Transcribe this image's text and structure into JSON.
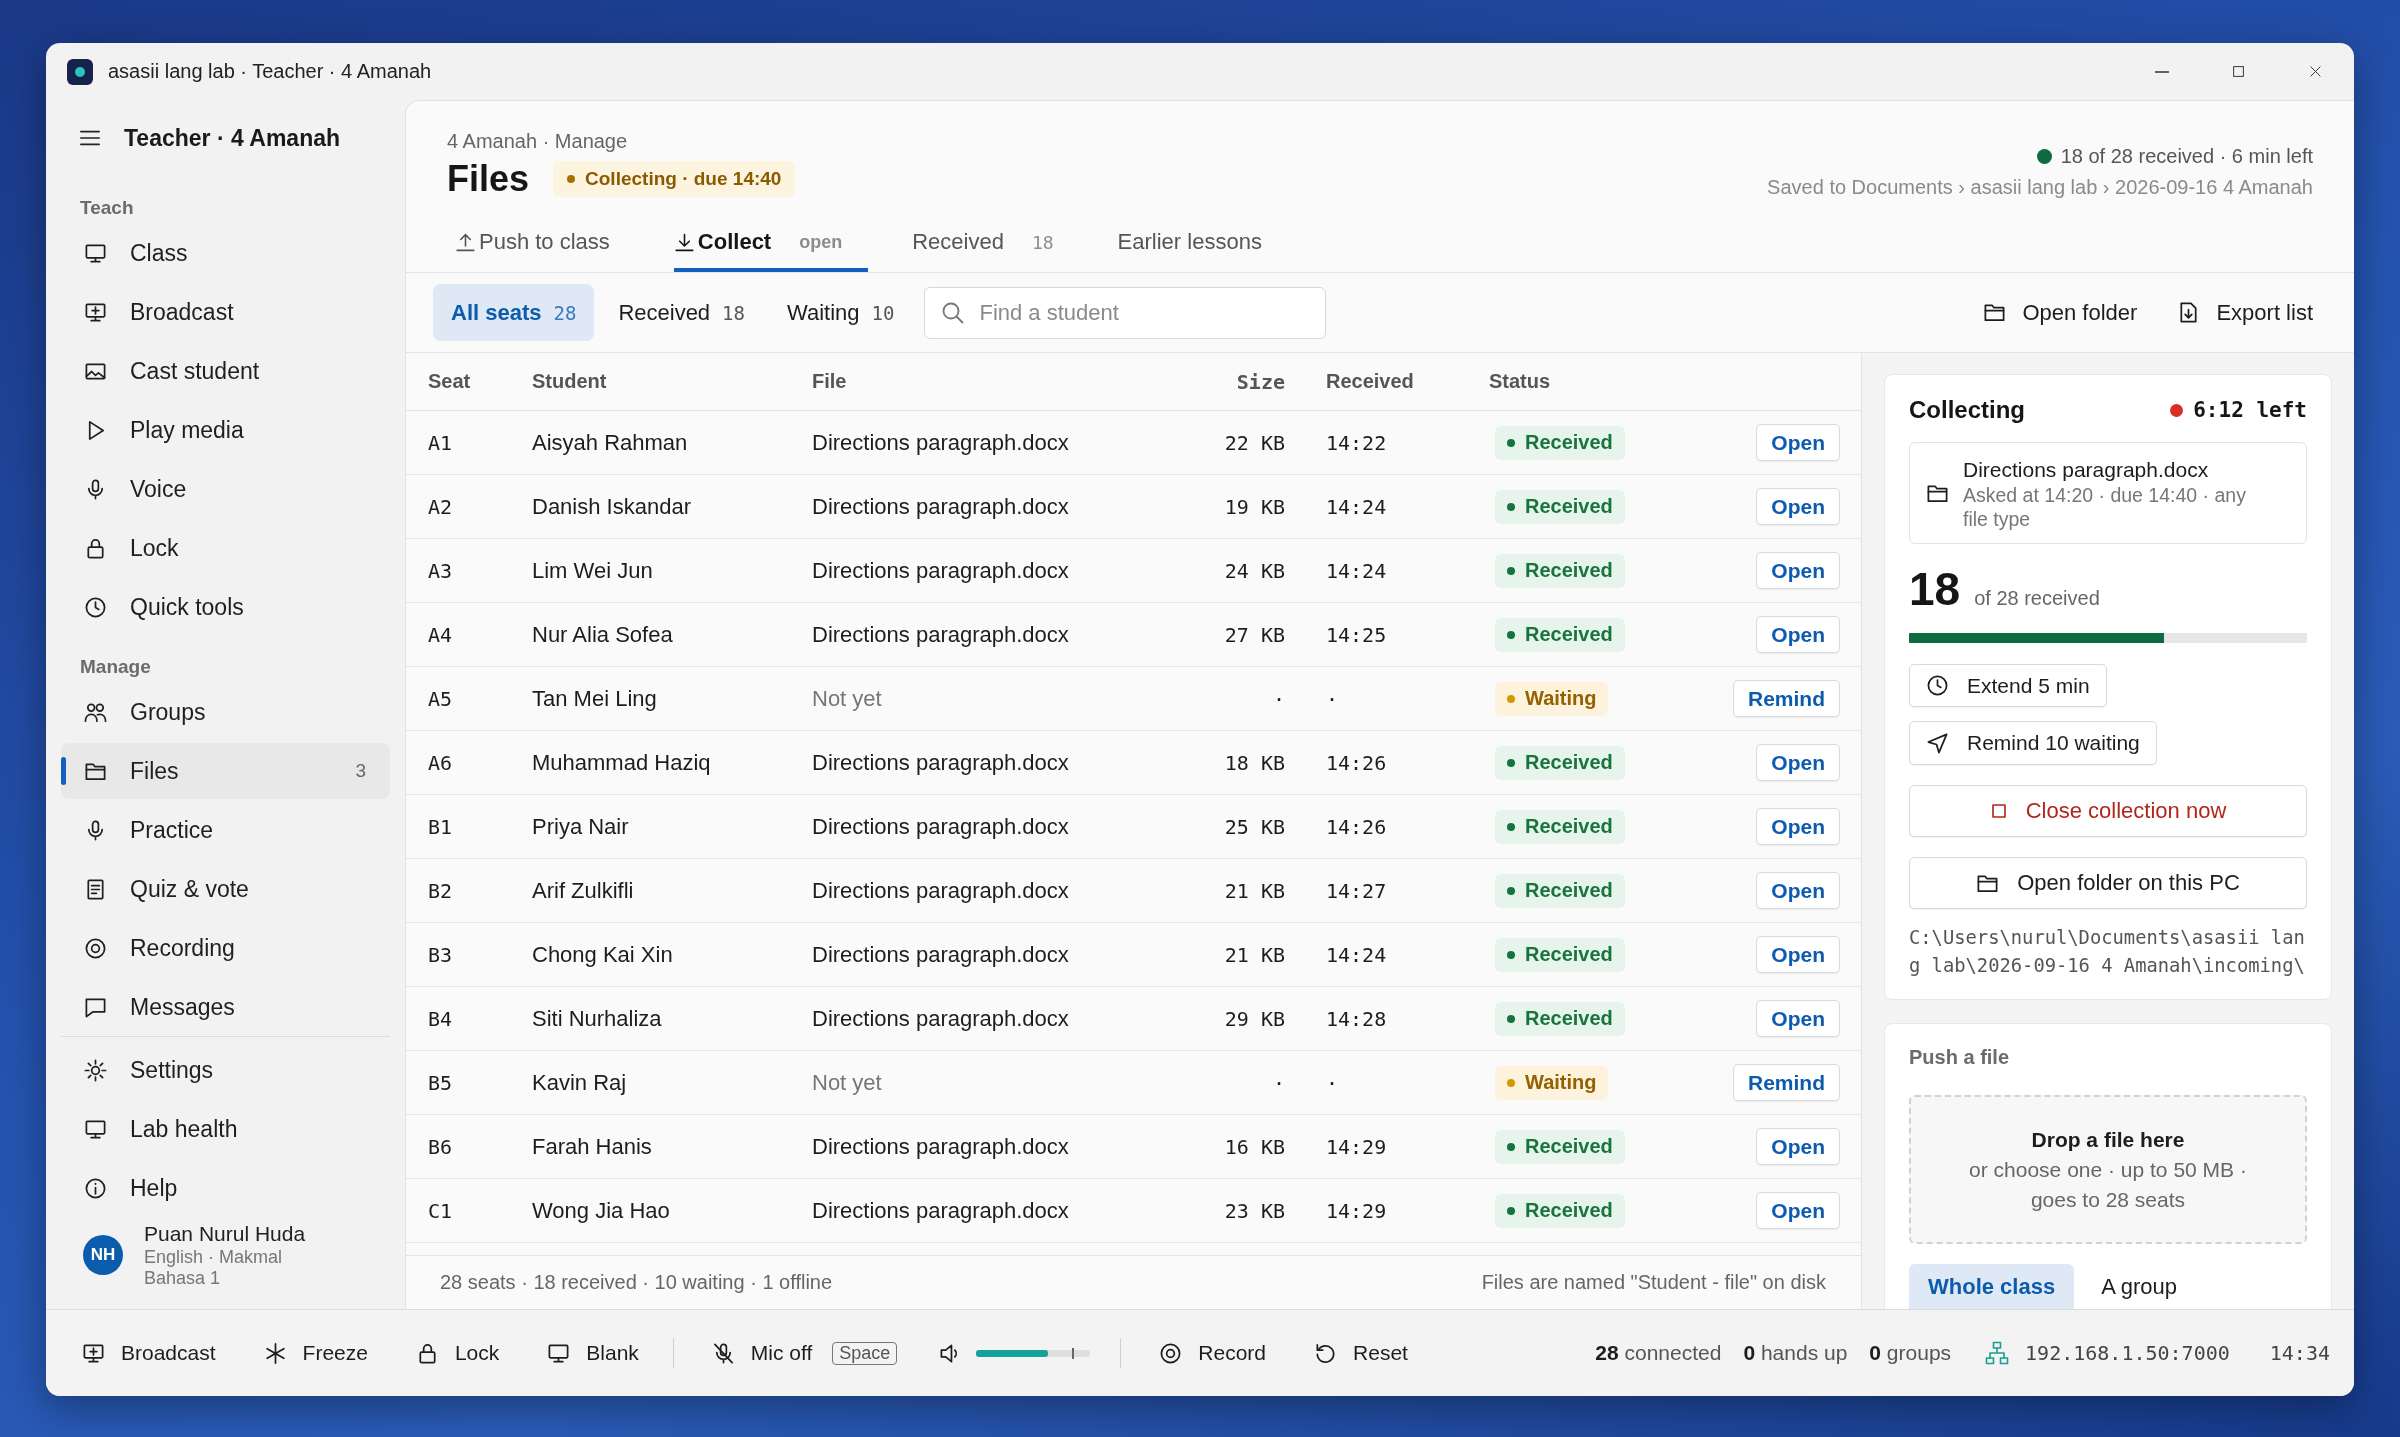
{
  "window": {
    "title": "asasii lang lab · Teacher · 4 Amanah"
  },
  "sidebar": {
    "title": "Teacher · 4 Amanah",
    "sections": [
      {
        "heading": "Teach",
        "items": [
          {
            "label": "Class",
            "selected": false
          },
          {
            "label": "Broadcast",
            "selected": false
          },
          {
            "label": "Cast student",
            "selected": false
          },
          {
            "label": "Play media",
            "selected": false
          },
          {
            "label": "Voice",
            "selected": false
          },
          {
            "label": "Lock",
            "selected": false
          },
          {
            "label": "Quick tools",
            "selected": false
          }
        ]
      },
      {
        "heading": "Manage",
        "items": [
          {
            "label": "Groups",
            "selected": false
          },
          {
            "label": "Files",
            "count": "3",
            "selected": true
          },
          {
            "label": "Practice",
            "selected": false
          },
          {
            "label": "Quiz & vote",
            "selected": false
          },
          {
            "label": "Recording",
            "selected": false
          },
          {
            "label": "Messages",
            "selected": false
          }
        ]
      }
    ],
    "footer_items": [
      {
        "label": "Settings",
        "selected": false
      },
      {
        "label": "Lab health",
        "selected": false
      },
      {
        "label": "Help",
        "selected": false
      }
    ],
    "user": {
      "initials": "NH",
      "name": "Puan Nurul Huda",
      "detail": "English · Makmal Bahasa 1"
    }
  },
  "header": {
    "breadcrumb": "4 Amanah · Manage",
    "title": "Files",
    "badge": "Collecting · due 14:40",
    "status": "18 of 28 received · 6 min left",
    "save_path": "Saved to Documents › asasii lang lab › 2026-09-16 4 Amanah"
  },
  "tabs": [
    {
      "label": "Push to class",
      "selected": false
    },
    {
      "label": "Collect",
      "badge": "open",
      "selected": true
    },
    {
      "label": "Received",
      "count": "18",
      "selected": false
    },
    {
      "label": "Earlier lessons",
      "selected": false
    }
  ],
  "filters": [
    {
      "label": "All seats",
      "count": "28",
      "selected": true
    },
    {
      "label": "Received",
      "count": "18",
      "selected": false
    },
    {
      "label": "Waiting",
      "count": "10",
      "selected": false
    }
  ],
  "search": {
    "placeholder": "Find a student"
  },
  "actions": [
    "Open folder",
    "Export list"
  ],
  "table": {
    "columns": [
      "Seat",
      "Student",
      "File",
      "Size",
      "Received",
      "Status"
    ],
    "rows": [
      {
        "seat": "A1",
        "student": "Aisyah Rahman",
        "file": "Directions paragraph.docx",
        "size": "22 KB",
        "received": "14:22",
        "status": "Received",
        "kind": "received",
        "action": "Open"
      },
      {
        "seat": "A2",
        "student": "Danish Iskandar",
        "file": "Directions paragraph.docx",
        "size": "19 KB",
        "received": "14:24",
        "status": "Received",
        "kind": "received",
        "action": "Open"
      },
      {
        "seat": "A3",
        "student": "Lim Wei Jun",
        "file": "Directions paragraph.docx",
        "size": "24 KB",
        "received": "14:24",
        "status": "Received",
        "kind": "received",
        "action": "Open"
      },
      {
        "seat": "A4",
        "student": "Nur Alia Sofea",
        "file": "Directions paragraph.docx",
        "size": "27 KB",
        "received": "14:25",
        "status": "Received",
        "kind": "received",
        "action": "Open"
      },
      {
        "seat": "A5",
        "student": "Tan Mei Ling",
        "file": "Not yet",
        "size": "·",
        "received": "·",
        "status": "Waiting",
        "kind": "waiting",
        "action": "Remind"
      },
      {
        "seat": "A6",
        "student": "Muhammad Haziq",
        "file": "Directions paragraph.docx",
        "size": "18 KB",
        "received": "14:26",
        "status": "Received",
        "kind": "received",
        "action": "Open"
      },
      {
        "seat": "B1",
        "student": "Priya Nair",
        "file": "Directions paragraph.docx",
        "size": "25 KB",
        "received": "14:26",
        "status": "Received",
        "kind": "received",
        "action": "Open"
      },
      {
        "seat": "B2",
        "student": "Arif Zulkifli",
        "file": "Directions paragraph.docx",
        "size": "21 KB",
        "received": "14:27",
        "status": "Received",
        "kind": "received",
        "action": "Open"
      },
      {
        "seat": "B3",
        "student": "Chong Kai Xin",
        "file": "Directions paragraph.docx",
        "size": "21 KB",
        "received": "14:24",
        "status": "Received",
        "kind": "received",
        "action": "Open"
      },
      {
        "seat": "B4",
        "student": "Siti Nurhaliza",
        "file": "Directions paragraph.docx",
        "size": "29 KB",
        "received": "14:28",
        "status": "Received",
        "kind": "received",
        "action": "Open"
      },
      {
        "seat": "B5",
        "student": "Kavin Raj",
        "file": "Not yet",
        "size": "·",
        "received": "·",
        "status": "Waiting",
        "kind": "waiting",
        "action": "Remind"
      },
      {
        "seat": "B6",
        "student": "Farah Hanis",
        "file": "Directions paragraph.docx",
        "size": "16 KB",
        "received": "14:29",
        "status": "Received",
        "kind": "received",
        "action": "Open"
      },
      {
        "seat": "C1",
        "student": "Wong Jia Hao",
        "file": "Directions paragraph.docx",
        "size": "23 KB",
        "received": "14:29",
        "status": "Received",
        "kind": "received",
        "action": "Open"
      }
    ]
  },
  "table_footer": {
    "summary": "28 seats · 18 received · 10 waiting · 1 offline",
    "note": "Files are named \"Student - file\" on disk"
  },
  "collecting": {
    "title": "Collecting",
    "time_left": "6:12 left",
    "file": {
      "name": "Directions paragraph.docx",
      "detail": "Asked at 14:20 · due 14:40 · any file type"
    },
    "received_count": "18",
    "received_label": "of 28 received",
    "progress": {
      "level": 0.64
    },
    "buttons": [
      "Extend 5 min",
      "Remind 10 waiting"
    ],
    "close_button": "Close collection now",
    "folder_button": "Open folder on this PC",
    "path": "C:\\Users\\nurul\\Documents\\asasii lang lab\\2026-09-16 4 Amanah\\incoming\\"
  },
  "push": {
    "title": "Push a file",
    "drop_title": "Drop a file here",
    "drop_hint": "or choose one · up to 50 MB · goes to 28 seats",
    "targets": [
      {
        "label": "Whole class",
        "selected": true
      },
      {
        "label": "A group",
        "selected": false
      }
    ]
  },
  "bottom_bar": {
    "tools": [
      "Broadcast",
      "Freeze",
      "Lock",
      "Blank"
    ],
    "mic": {
      "label": "Mic off",
      "shortcut": "Space"
    },
    "volume": {
      "level": 0.63
    },
    "actions": [
      "Record",
      "Reset"
    ],
    "stats": [
      "**28** connected",
      "**0** hands up",
      "**0** groups"
    ],
    "address": "192.168.1.50:7000",
    "time": "14:34"
  }
}
